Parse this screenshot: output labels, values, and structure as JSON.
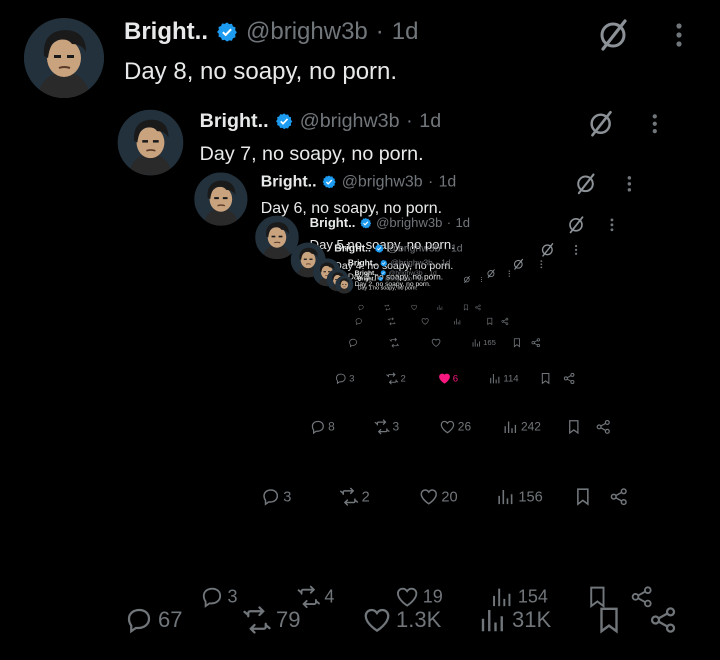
{
  "tweets": [
    {
      "name": "Bright..",
      "handle": "@brighw3b",
      "dot": "·",
      "time": "1d",
      "text": "Day 8, no soapy, no porn.",
      "replies": "67",
      "reposts": "79",
      "likes": "1.3K",
      "views": "31K"
    },
    {
      "name": "Bright..",
      "handle": "@brighw3b",
      "dot": "·",
      "time": "1d",
      "text": "Day 7, no soapy, no porn.",
      "replies": "3",
      "reposts": "4",
      "likes": "19",
      "views": "154"
    },
    {
      "name": "Bright..",
      "handle": "@brighw3b",
      "dot": "·",
      "time": "1d",
      "text": "Day 6, no soapy, no porn.",
      "replies": "3",
      "reposts": "2",
      "likes": "20",
      "views": "156"
    },
    {
      "name": "Bright..",
      "handle": "@brighw3b",
      "dot": "·",
      "time": "1d",
      "text": "Day 5,no soapy, no porn.",
      "replies": "8",
      "reposts": "3",
      "likes": "26",
      "views": "242"
    },
    {
      "name": "Bright..",
      "handle": "@brighw3b",
      "dot": "·",
      "time": "1d",
      "text": "Day 4. no soapy, no porn.",
      "replies": "3",
      "reposts": "2",
      "likes": "6",
      "views": "114"
    },
    {
      "name": "Bright..",
      "handle": "@brighw3b",
      "dot": "·",
      "time": "1d",
      "text": "Day 3, no soapy, no porn.",
      "replies": "",
      "reposts": "",
      "likes": "",
      "views": "165"
    },
    {
      "name": "Bright..",
      "handle": "@brighw3b",
      "dot": "·",
      "time": "1d",
      "text": "Day 2, no soapy, no porn.",
      "replies": "",
      "reposts": "",
      "likes": "",
      "views": ""
    },
    {
      "name": "Bright..",
      "handle": "@brighw3b",
      "dot": "·",
      "time": "1d",
      "text": "Day 1 no soapy, no porn.",
      "replies": "",
      "reposts": "",
      "likes": "",
      "views": ""
    }
  ],
  "icons": {
    "reply": "reply-icon",
    "repost": "repost-icon",
    "like": "heart-icon",
    "views": "views-icon",
    "bookmark": "bookmark-icon",
    "share": "share-icon",
    "grok": "grok-icon",
    "more": "more-icon",
    "verified": "verified-badge-icon"
  },
  "colors": {
    "background": "#000000",
    "text": "#e7e9ea",
    "muted": "#71767b",
    "verified": "#1d9bf0",
    "like_active": "#f91880"
  },
  "liked_level_index": 4
}
